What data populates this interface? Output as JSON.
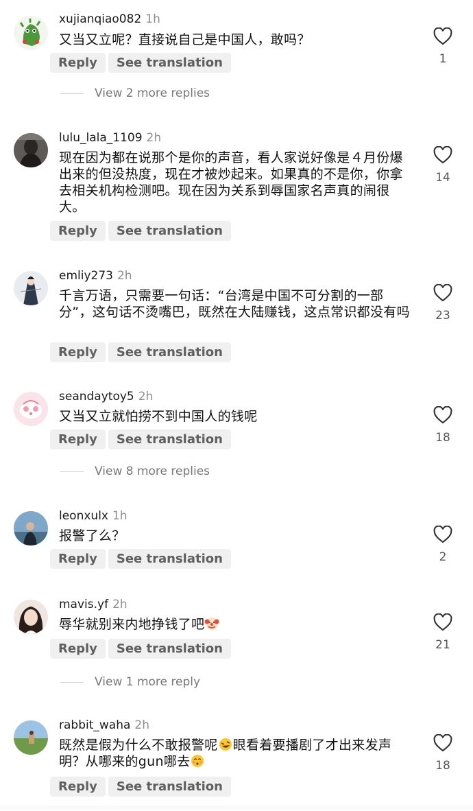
{
  "labels": {
    "reply": "Reply",
    "see_translation": "See translation"
  },
  "comments": [
    {
      "username": "xujianqiao082",
      "time": "1h",
      "text": "又当又立呢？直接说自己是中国人，敢吗？",
      "likes": "1",
      "more": "View 2 more replies"
    },
    {
      "username": "lulu_lala_1109",
      "time": "2h",
      "text": "现在因为都在说那个是你的声音，看人家说好像是４月份爆出来的但没热度，现在才被炒起来。如果真的不是你，你拿去相关机构检测吧。现在因为关系到辱国家名声真的闹很大。",
      "likes": "14"
    },
    {
      "username": "emliy273",
      "time": "2h",
      "text": "千言万语，只需要一句话：“台湾是中国不可分割的一部分”，这句话不烫嘴巴，既然在大陆赚钱，这点常识都没有吗",
      "likes": "23"
    },
    {
      "username": "seandaytoy5",
      "time": "2h",
      "text": "又当又立就怕捞不到中国人的钱呢",
      "likes": "18",
      "more": "View 8 more replies"
    },
    {
      "username": "leonxulx",
      "time": "1h",
      "text": "报警了么？",
      "likes": "2"
    },
    {
      "username": "mavis.yf",
      "time": "2h",
      "text": "辱华就别来内地挣钱了吧",
      "likes": "21",
      "more": "View 1 more reply"
    },
    {
      "username": "rabbit_waha",
      "time": "2h",
      "text1": "既然是假为什么不敢报警呢",
      "text2": "眼看着要播剧了才出来发声明？从哪来的gun哪去",
      "likes": "18"
    }
  ]
}
